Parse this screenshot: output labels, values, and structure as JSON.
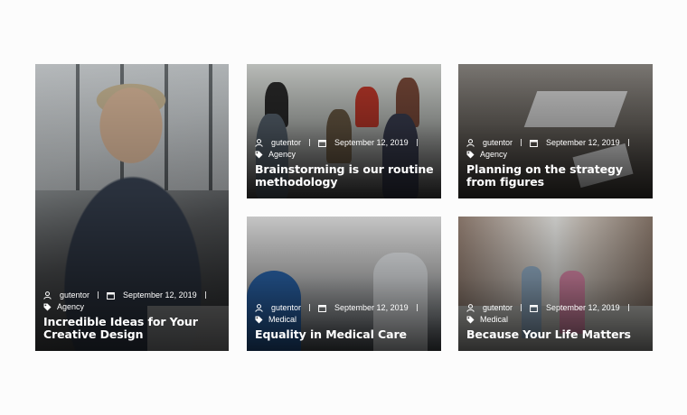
{
  "posts": [
    {
      "author": "gutentor",
      "date": "September 12, 2019",
      "category": "Agency",
      "title": "Incredible Ideas for Your Creative Design"
    },
    {
      "author": "gutentor",
      "date": "September 12, 2019",
      "category": "Agency",
      "title": "Brainstorming is our routine methodology"
    },
    {
      "author": "gutentor",
      "date": "September 12, 2019",
      "category": "Agency",
      "title": "Planning on the strategy from figures"
    },
    {
      "author": "gutentor",
      "date": "September 12, 2019",
      "category": "Medical",
      "title": "Equality in Medical Care"
    },
    {
      "author": "gutentor",
      "date": "September 12, 2019",
      "category": "Medical",
      "title": "Because Your Life Matters"
    }
  ]
}
